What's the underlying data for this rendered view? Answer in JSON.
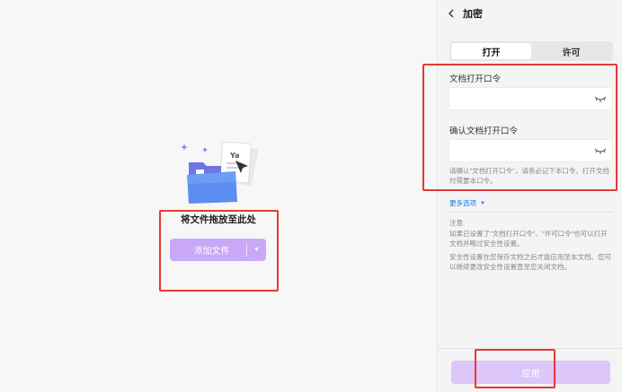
{
  "left": {
    "drop_title": "将文件拖放至此处",
    "add_button": {
      "label": "添加文件",
      "caret_icon": "caret-down-icon"
    },
    "illustration_icon": "folder-documents-icon"
  },
  "panel": {
    "title": "加密",
    "back_icon": "chevron-left-icon",
    "tabs": [
      {
        "label": "打开",
        "active": true
      },
      {
        "label": "许可",
        "active": false
      }
    ],
    "open_password": {
      "label": "文档打开口令",
      "value": "",
      "placeholder": ""
    },
    "confirm_password": {
      "label": "确认文档打开口令",
      "value": "",
      "placeholder": ""
    },
    "eye_icon": "eye-closed-icon",
    "hint": "请确认\"文档打开口令\"，请务必记下本口令。打开文档时需要本口令。",
    "more_options": "更多选项",
    "note_title": "注意:",
    "note_1": "如果已设置了\"文档打开口令\"、\"许可口令\"也可以打开文档并略过安全性设置。",
    "note_2": "安全性设置在您保存文档之后才能应用至本文档。您可以继续更改安全性设置直至您关闭文档。",
    "apply_button": "应用"
  },
  "colors": {
    "accent_purple": "#c8a8f7",
    "apply_disabled": "#dcc6fa",
    "highlight_red": "#e53935",
    "link_blue": "#1a73e8"
  }
}
